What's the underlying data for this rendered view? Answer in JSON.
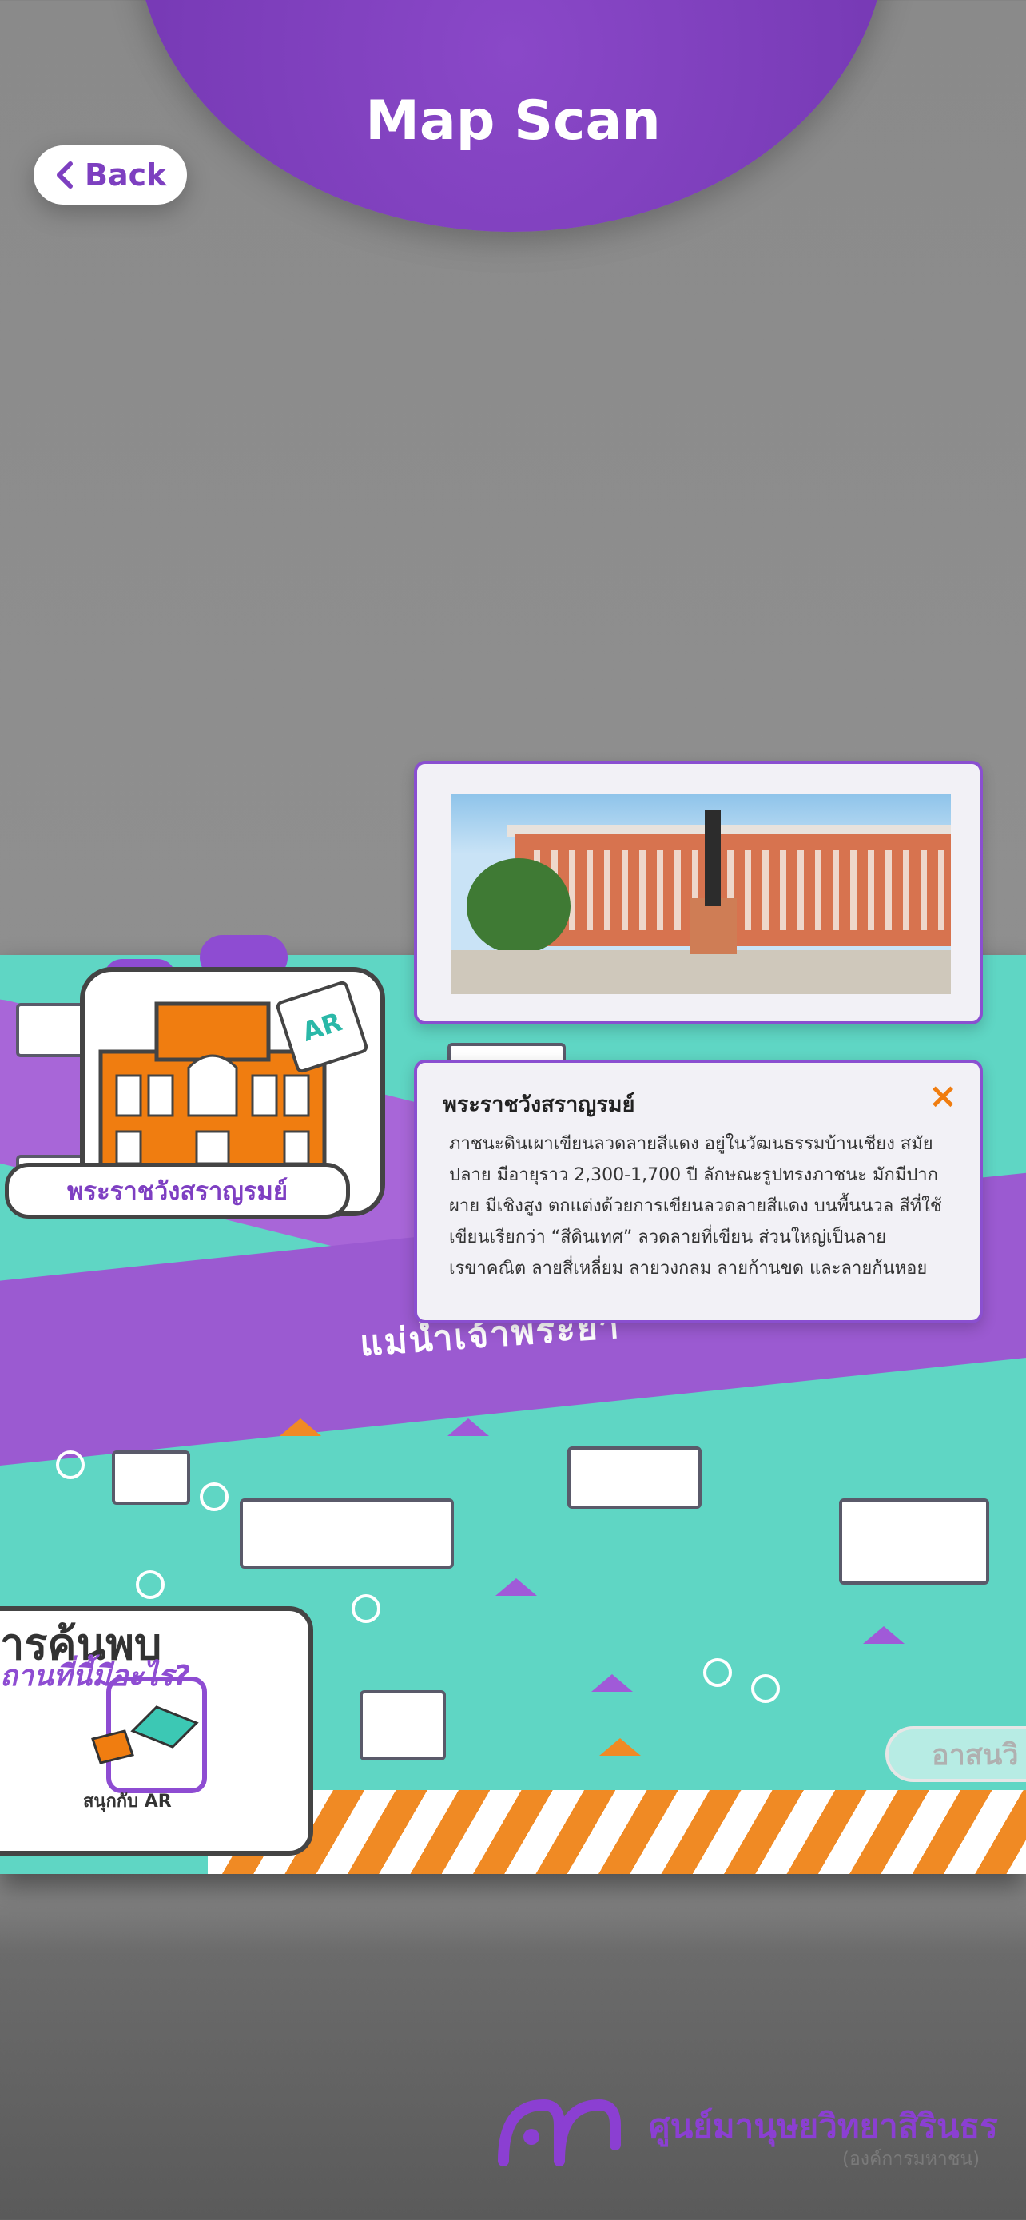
{
  "header": {
    "title": "Map Scan",
    "back_label": "Back"
  },
  "map": {
    "river_label": "แม่น้ำเจ้าพระยา",
    "landmark_label": "พระราชวังสราญรมย์",
    "ar_badge": "AR",
    "discover_title": "ารค้นพบ",
    "discover_subtitle": "ถานที่นี้มีอะไร?",
    "discover_ar_label": "สนุกกับ AR",
    "side_pill": "อาสนวิ"
  },
  "info": {
    "title": "พระราชวังสราญรมย์",
    "body": "ภาชนะดินเผาเขียนลวดลายสีแดง อยู่ในวัฒนธรรมบ้านเชียง สมัยปลาย มีอายุราว 2,300-1,700 ปี ลักษณะรูปทรงภาชนะ มักมีปากผาย มีเชิงสูง ตกแต่งด้วยการเขียนลวดลายสีแดง บนพื้นนวล สีที่ใช้เขียนเรียกว่า “สีดินเทศ” ลวดลายที่เขียน ส่วนใหญ่เป็นลายเรขาคณิต ลายสี่เหลี่ยม ลายวงกลม ลายก้านขด และลายก้นหอย",
    "close_label": "×"
  },
  "footer": {
    "org_name": "ศูนย์มานุษยวิทยาสิรินธร",
    "org_sub": "(องค์การมหาชน)"
  },
  "colors": {
    "brand_purple": "#7d3fc0",
    "accent_orange": "#f07d10",
    "map_teal": "#5fd6c4"
  }
}
